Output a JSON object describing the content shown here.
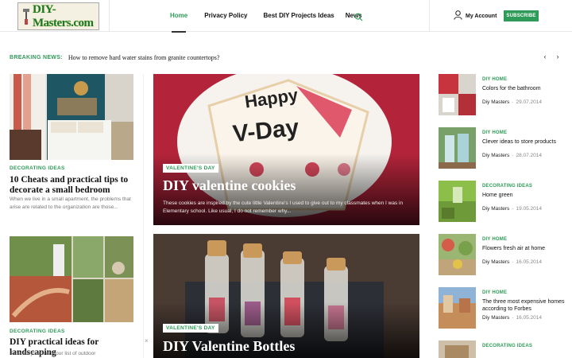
{
  "header": {
    "logo_text": "DIY-Masters.com",
    "nav": [
      "Home",
      "Privacy Policy",
      "Best DIY Projects Ideas",
      "News"
    ],
    "account_label": "My Account",
    "subscribe_label": "SUBSCRIBE"
  },
  "breaking": {
    "label": "BREAKING NEWS:",
    "text": "How to remove hard water stains from granite countertops?"
  },
  "left_posts": [
    {
      "category": "DECORATING IDEAS",
      "title": "10 Cheats and practical tips to decorate a small bedroom",
      "excerpt": "When we live in a small apartment, the problems that arise are related to the organization are those..."
    },
    {
      "category": "DECORATING IDEAS",
      "title": "DIY practical ideas for landscaping",
      "excerpt": "If the alleys are on your list of outdoor"
    }
  ],
  "features": [
    {
      "badge": "VALENTINE'S DAY",
      "title": "DIY valentine cookies",
      "excerpt": "These cookies are inspired by the cute little Valentine's I used to give out to my classmates when I was in Elementary school. Like usual, I do not remember why...",
      "cookie_text_1": "Happy",
      "cookie_text_2": "V-Day"
    },
    {
      "badge": "VALENTINE'S DAY",
      "title": "DIY Valentine Bottles"
    }
  ],
  "right_posts": [
    {
      "category": "DIY HOME",
      "title": "Colors for the bathroom",
      "author": "Diy Masters",
      "date": "29.07.2014"
    },
    {
      "category": "DIY HOME",
      "title": "Clever ideas to store products",
      "author": "Diy Masters",
      "date": "28.07.2014"
    },
    {
      "category": "DECORATING IDEAS",
      "title": "Home green",
      "author": "Diy Masters",
      "date": "19.05.2014"
    },
    {
      "category": "DIY HOME",
      "title": "Flowers fresh air at home",
      "author": "Diy Masters",
      "date": "16.05.2014"
    },
    {
      "category": "DIY HOME",
      "title": "The three most expensive homes according to Forbes",
      "author": "Diy Masters",
      "date": "16.05.2014"
    },
    {
      "category": "DECORATING IDEAS"
    }
  ],
  "colors": {
    "accent": "#2f9b58",
    "text": "#111111",
    "muted": "#777777"
  },
  "icons": [
    "search-icon",
    "user-icon",
    "chevron-left-icon",
    "chevron-right-icon",
    "close-icon"
  ]
}
